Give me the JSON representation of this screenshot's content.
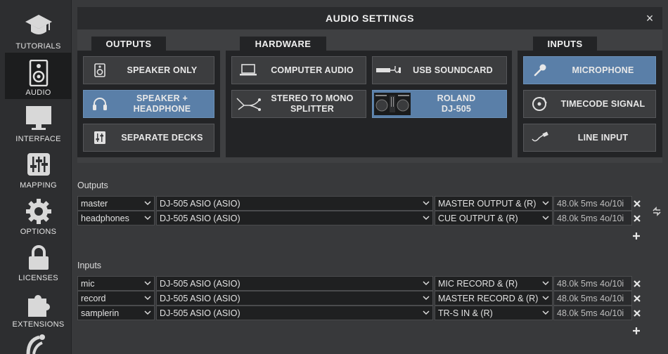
{
  "sidebar": {
    "items": [
      {
        "label": "TUTORIALS",
        "icon": "graduation-cap-icon",
        "active": false
      },
      {
        "label": "AUDIO",
        "icon": "speaker-icon",
        "active": true
      },
      {
        "label": "INTERFACE",
        "icon": "monitor-icon",
        "active": false
      },
      {
        "label": "MAPPING",
        "icon": "sliders-icon",
        "active": false
      },
      {
        "label": "OPTIONS",
        "icon": "gear-icon",
        "active": false
      },
      {
        "label": "LICENSES",
        "icon": "lock-icon",
        "active": false
      },
      {
        "label": "EXTENSIONS",
        "icon": "puzzle-icon",
        "active": false
      }
    ]
  },
  "modal": {
    "title": "AUDIO SETTINGS",
    "close": "×",
    "groups": {
      "outputs": {
        "label": "OUTPUTS"
      },
      "hardware": {
        "label": "HARDWARE"
      },
      "inputs": {
        "label": "INPUTS"
      }
    },
    "buttons": {
      "speaker_only": "SPEAKER ONLY",
      "speaker_headphone_1": "SPEAKER +",
      "speaker_headphone_2": "HEADPHONE",
      "separate_decks": "SEPARATE DECKS",
      "computer_audio": "COMPUTER AUDIO",
      "usb_soundcard": "USB SOUNDCARD",
      "stereo_mono_1": "STEREO TO MONO",
      "stereo_mono_2": "SPLITTER",
      "roland_1": "ROLAND",
      "roland_2": "DJ-505",
      "microphone": "MICROPHONE",
      "timecode": "TIMECODE SIGNAL",
      "line_input": "LINE INPUT"
    },
    "accent": "#5a7fa8"
  },
  "outputs": {
    "title": "Outputs",
    "rows": [
      {
        "name": "master",
        "device": "DJ-505 ASIO (ASIO)",
        "channel": "MASTER OUTPUT & (R)",
        "info": "48.0k 5ms 4o/10i"
      },
      {
        "name": "headphones",
        "device": "DJ-505 ASIO (ASIO)",
        "channel": "CUE OUTPUT & (R)",
        "info": "48.0k 5ms 4o/10i"
      }
    ]
  },
  "inputs": {
    "title": "Inputs",
    "rows": [
      {
        "name": "mic",
        "device": "DJ-505 ASIO (ASIO)",
        "channel": "MIC RECORD & (R)",
        "info": "48.0k 5ms 4o/10i"
      },
      {
        "name": "record",
        "device": "DJ-505 ASIO (ASIO)",
        "channel": "MASTER RECORD & (R)",
        "info": "48.0k 5ms 4o/10i"
      },
      {
        "name": "samplerin",
        "device": "DJ-505 ASIO (ASIO)",
        "channel": "TR-S IN & (R)",
        "info": "48.0k 5ms 4o/10i"
      }
    ]
  }
}
